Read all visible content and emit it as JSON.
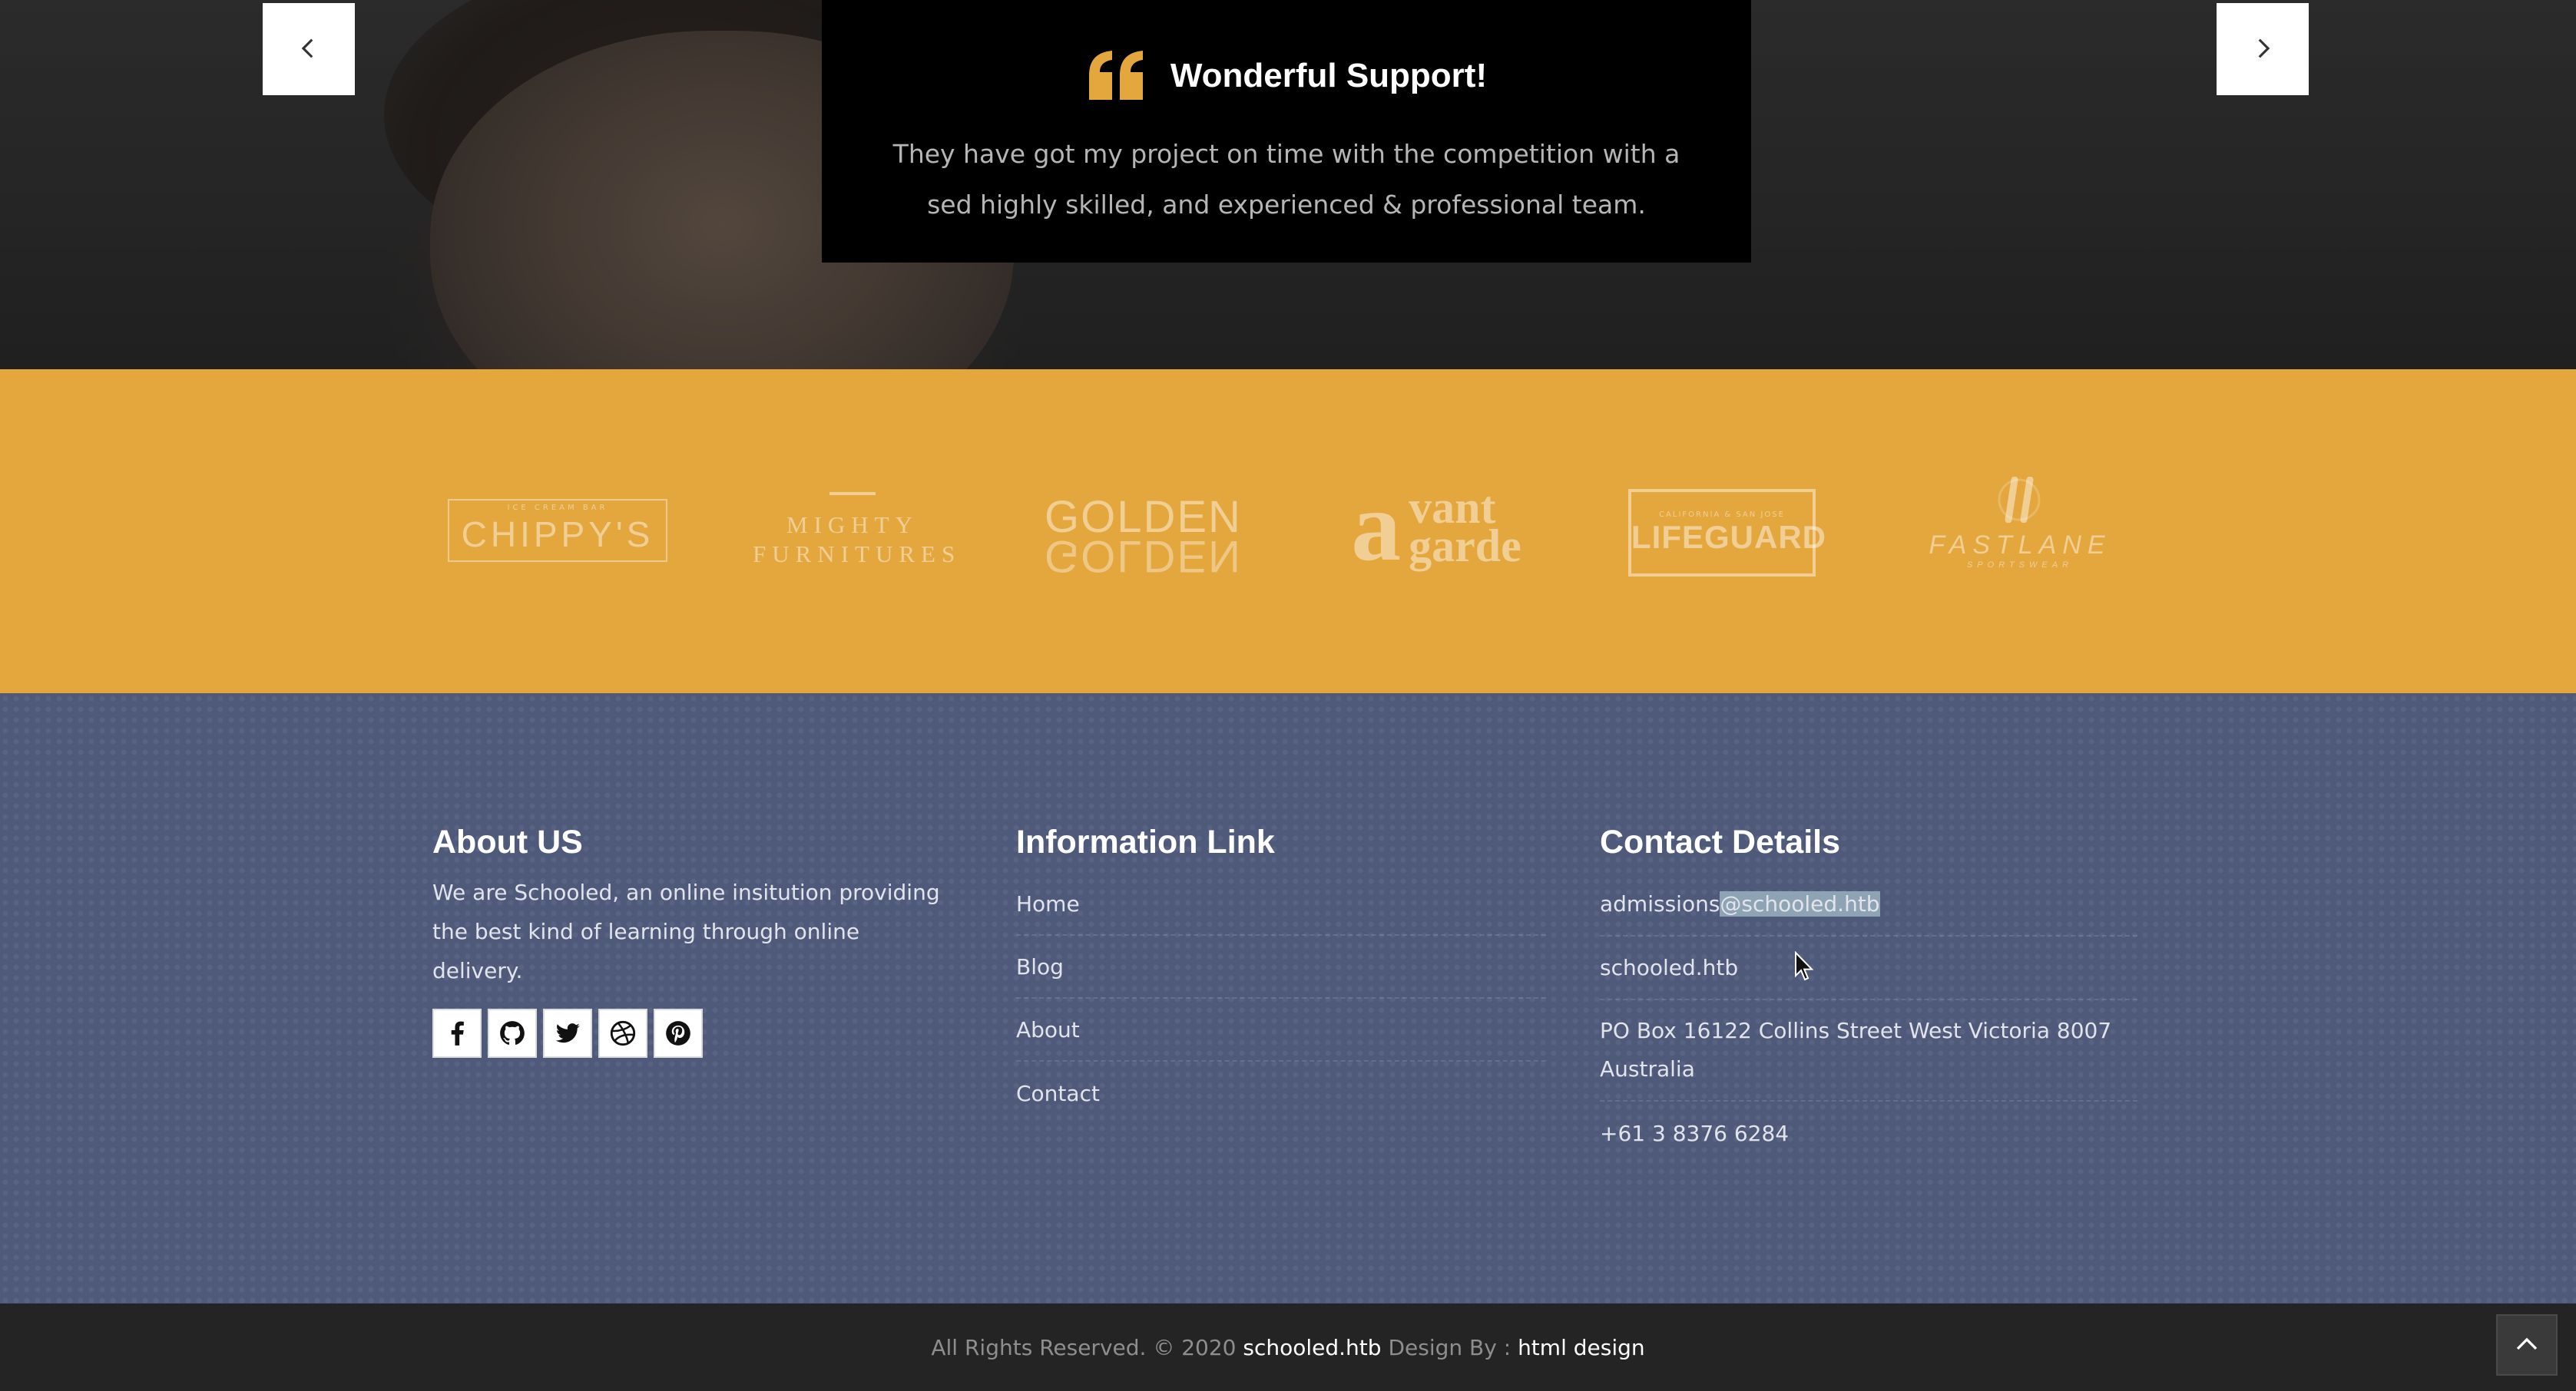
{
  "testimonial": {
    "title": "Wonderful Support!",
    "text": "They have got my project on time with the competition with a sed highly skilled, and experienced & professional team.",
    "prev_icon": "chevron-left-icon",
    "next_icon": "chevron-right-icon",
    "quote_icon": "quote-icon",
    "colors": {
      "quote_icon": "#e3a73d",
      "box": "#000000"
    }
  },
  "partners": {
    "background": "#e3a73d",
    "logos": [
      {
        "top_text": "ICE CREAM BAR",
        "name": "CHIPPY'S"
      },
      {
        "line1": "MIGHTY",
        "line2": "FURNITURES"
      },
      {
        "line1": "GOLDEN",
        "line2": "GOLDEN"
      },
      {
        "a": "a",
        "line1": "vant",
        "line2": "garde"
      },
      {
        "top_text": "CALIFORNIA & SAN JOSE",
        "name": "LIFEGUARD"
      },
      {
        "name": "FASTLANE",
        "sub": "SPORTSWEAR"
      }
    ]
  },
  "footer": {
    "background": "#4f5a7b",
    "about": {
      "heading": "About US",
      "text": "We are Schooled, an online insitution providing the best kind of learning through online delivery.",
      "social": [
        "facebook-icon",
        "github-icon",
        "twitter-icon",
        "dribbble-icon",
        "pinterest-icon"
      ]
    },
    "links": {
      "heading": "Information Link",
      "items": [
        "Home",
        "Blog",
        "About",
        "Contact"
      ]
    },
    "contact": {
      "heading": "Contact Details",
      "email_user": "admissions",
      "email_domain": "@schooled.htb",
      "website": "schooled.htb",
      "address_line1": "PO Box 16122 Collins Street West Victoria 8007",
      "address_line2": "Australia",
      "phone": "+61 3 8376 6284"
    }
  },
  "bottom": {
    "copyright": "All Rights Reserved. © 2020",
    "site": "schooled.htb",
    "design_by": "Design By :",
    "designer": "html design",
    "scroll_top_icon": "chevron-up-icon"
  }
}
